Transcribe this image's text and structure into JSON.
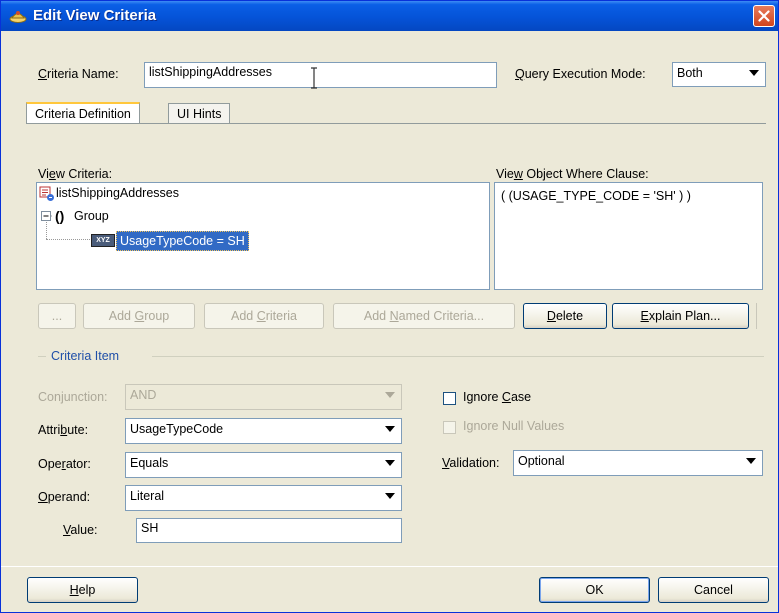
{
  "window": {
    "title": "Edit View Criteria"
  },
  "criteria_name": {
    "label": "Criteria Name:",
    "value": "listShippingAddresses"
  },
  "query_execution": {
    "label": "Query Execution Mode:",
    "value": "Both"
  },
  "tabs": [
    {
      "label": "Criteria Definition",
      "selected": true
    },
    {
      "label": "UI Hints",
      "selected": false
    }
  ],
  "view_criteria": {
    "label": "View Criteria:",
    "tree": {
      "root": "listShippingAddresses",
      "group_symbol": "()",
      "group": "Group",
      "item_badge": "XYZ",
      "item": "UsageTypeCode = SH"
    }
  },
  "where_clause": {
    "label": "View Object Where Clause:",
    "value": "( (USAGE_TYPE_CODE = 'SH' ) )"
  },
  "toolbar": {
    "ellipsis": "...",
    "add_group": "Add Group",
    "add_criteria": "Add Criteria",
    "add_named_criteria": "Add Named Criteria...",
    "delete": "Delete",
    "explain_plan": "Explain Plan..."
  },
  "criteria_item": {
    "section_title": "Criteria Item",
    "conjunction": {
      "label": "Conjunction:",
      "value": "AND",
      "enabled": false
    },
    "attribute": {
      "label": "Attribute:",
      "value": "UsageTypeCode"
    },
    "operator": {
      "label": "Operator:",
      "value": "Equals"
    },
    "operand": {
      "label": "Operand:",
      "value": "Literal"
    },
    "value": {
      "label": "Value:",
      "value": "SH"
    },
    "ignore_case": {
      "label": "Ignore Case",
      "checked": false
    },
    "ignore_null_values": {
      "label": "Ignore Null Values",
      "checked": false,
      "enabled": false
    },
    "validation": {
      "label": "Validation:",
      "value": "Optional"
    }
  },
  "footer": {
    "help": "Help",
    "ok": "OK",
    "cancel": "Cancel"
  },
  "colors": {
    "title_bar": "#0553d8",
    "selection": "#316ac5",
    "dialog_bg": "#ece9d8"
  },
  "icons": [
    "app-icon",
    "close-icon",
    "view-criteria-icon",
    "tree-collapse-icon",
    "attribute-badge-icon",
    "text-cursor-icon"
  ]
}
